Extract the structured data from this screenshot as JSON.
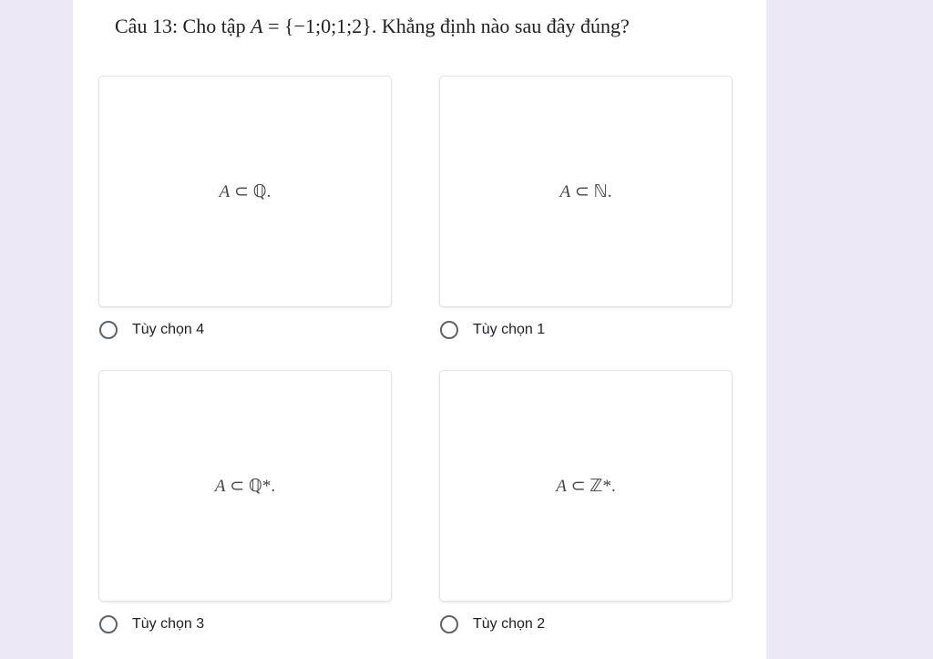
{
  "question": {
    "prefix": "Câu 13: Cho tập ",
    "set_var": "A",
    "set_eq": " = ",
    "set_body": "{−1;0;1;2}",
    "suffix": ". Khẳng định nào sau đây đúng?"
  },
  "options": [
    {
      "formula_var": "A",
      "formula_rest": " ⊂ ℚ.",
      "label": "Tùy chọn 4"
    },
    {
      "formula_var": "A",
      "formula_rest": " ⊂ ℕ.",
      "label": "Tùy chọn 1"
    },
    {
      "formula_var": "A",
      "formula_rest": " ⊂ ℚ*.",
      "label": "Tùy chọn 3"
    },
    {
      "formula_var": "A",
      "formula_rest": " ⊂ ℤ*.",
      "label": "Tùy chọn 2"
    }
  ],
  "colors": {
    "page_background": "#ece8f6",
    "card_background": "#ffffff",
    "radio_border": "#5f6368"
  }
}
